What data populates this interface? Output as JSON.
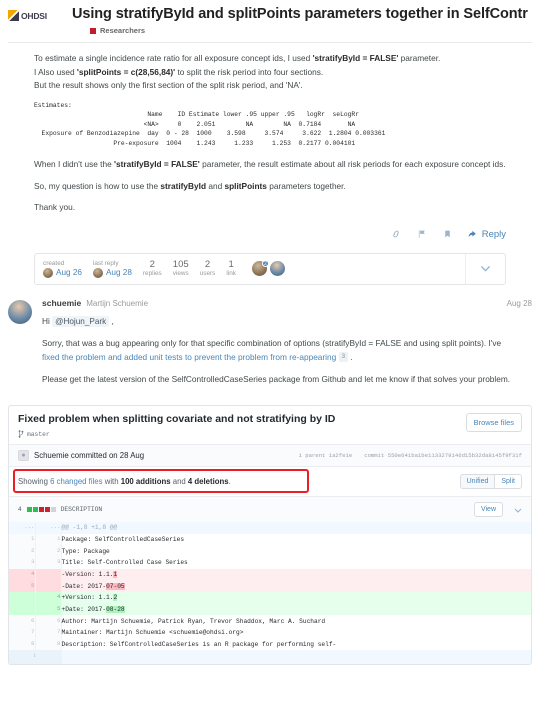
{
  "header": {
    "logo_text": "OHDSI",
    "topic_title": "Using stratifyById and splitPoints parameters together in SelfContr",
    "category": "Researchers"
  },
  "first_post": {
    "paragraphs": [
      {
        "parts": [
          {
            "t": "To estimate a single incidence rate ratio for all exposure concept ids, I used ",
            "b": false
          },
          {
            "t": "'stratifyById = FALSE'",
            "b": true
          },
          {
            "t": " parameter.",
            "b": false
          }
        ]
      },
      {
        "parts": [
          {
            "t": "I Also used ",
            "b": false
          },
          {
            "t": "'splitPoints = c(28,56,84)'",
            "b": true
          },
          {
            "t": " to split the risk period into four sections.",
            "b": false
          }
        ]
      },
      {
        "parts": [
          {
            "t": "But the result shows only the first section of the split risk period, and 'NA'.",
            "b": false
          }
        ]
      }
    ],
    "code_block": "Estimates:\n                              Name    ID Estimate lower .95 upper .95   logRr  seLogRr\n                             <NA>     0    2.051        NA        NA  0.7184       NA\n  Exposure of Benzodiazepine  day  0 - 28  1000    3.598     3.574     3.622  1.2804 0.003361\n                     Pre-exposure  1004    1.243     1.233     1.253  0.2177 0.004101",
    "paragraphs_after": [
      {
        "parts": [
          {
            "t": "When I didn't use the ",
            "b": false
          },
          {
            "t": "'stratifyById = FALSE'",
            "b": true
          },
          {
            "t": " parameter, the result estimate about all risk periods for each exposure concept ids.",
            "b": false
          }
        ]
      },
      {
        "parts": [
          {
            "t": "So, my question is how to use the ",
            "b": false
          },
          {
            "t": "stratifyById",
            "b": true
          },
          {
            "t": " and ",
            "b": false
          },
          {
            "t": "splitPoints",
            "b": true
          },
          {
            "t": " parameters together.",
            "b": false
          }
        ]
      },
      {
        "parts": [
          {
            "t": "Thank you.",
            "b": false
          }
        ]
      }
    ],
    "controls": {
      "link_icon": "link-icon",
      "flag_icon": "flag-icon",
      "bookmark_icon": "bookmark-icon",
      "reply_label": "Reply"
    }
  },
  "topic_map": {
    "created_label": "created",
    "created_date": "Aug 26",
    "last_reply_label": "last reply",
    "last_reply_date": "Aug 28",
    "stats": [
      {
        "value": "2",
        "label": "replies"
      },
      {
        "value": "105",
        "label": "views"
      },
      {
        "value": "2",
        "label": "users"
      },
      {
        "value": "1",
        "label": "link"
      }
    ],
    "avatar_badge": "2",
    "expand_icon": "chevron-down-icon"
  },
  "reply_post": {
    "username": "schuemie",
    "fullname": "Martijn Schuemie",
    "date": "Aug 28",
    "greeting_prefix": "Hi ",
    "mention": "@Hojun_Park",
    "greeting_suffix": " ,",
    "body_line1_a": "Sorry, that was a bug appearing only for that specific combination of options (stratifyById = FALSE and using split points). I've ",
    "body_line1_link": "fixed the problem and added unit tests to prevent the problem from re-appearing",
    "body_line1_ref": "3",
    "body_line1_b": " .",
    "body_line2": "Please get the latest version of the SelfControlledCaseSeries package from Github and let me know if that solves your problem."
  },
  "github_card": {
    "commit_title": "Fixed problem when splitting covariate and not stratifying by ID",
    "branch_icon": "branch-icon",
    "branch": "master",
    "browse_files": "Browse files",
    "committer_avatar": "avatar-icon",
    "committed_text": "Schuemie committed on 28 Aug",
    "parent_label": "1 parent 1a2fe1e",
    "commit_label": "commit 550e641ba1be1133279146d15b32da8145f9f31f",
    "showing": {
      "prefix": "Showing ",
      "files_link": "6 changed files",
      "mid": " with ",
      "additions": "100 additions",
      "and": " and ",
      "deletions": "4 deletions",
      "suffix": "."
    },
    "unified_label": "Unified",
    "split_label": "Split",
    "annotation_color": "#ee1c24",
    "diff_file": {
      "changes_count": "4",
      "filename": "DESCRIPTION",
      "view_label": "View",
      "collapse_icon": "chevron-down-icon",
      "rows": [
        {
          "type": "hunk",
          "old": "...",
          "new": "...",
          "code": "@@ -1,8 +1,8 @@"
        },
        {
          "type": "ctx",
          "old": "1",
          "new": "1",
          "code": "Package: SelfControlledCaseSeries"
        },
        {
          "type": "ctx",
          "old": "2",
          "new": "2",
          "code": "Type: Package"
        },
        {
          "type": "ctx",
          "old": "3",
          "new": "3",
          "code": "Title: Self-Controlled Case Series"
        },
        {
          "type": "del",
          "old": "4",
          "new": "",
          "code": "-Version: 1.1.1",
          "hl": "1"
        },
        {
          "type": "del",
          "old": "5",
          "new": "",
          "code": "-Date: 2017-07-05",
          "hl": "07-05"
        },
        {
          "type": "add",
          "old": "",
          "new": "4",
          "code": "+Version: 1.1.2",
          "hl": "2"
        },
        {
          "type": "add",
          "old": "",
          "new": "5",
          "code": "+Date: 2017-08-28",
          "hl": "08-28"
        },
        {
          "type": "ctx",
          "old": "6",
          "new": "6",
          "code": "Author: Martijn Schuemie, Patrick Ryan, Trevor Shaddox, Marc A. Suchard"
        },
        {
          "type": "ctx",
          "old": "7",
          "new": "7",
          "code": "Maintainer: Martijn Schuemie <schuemie@ohdsi.org>"
        },
        {
          "type": "ctx",
          "old": "8",
          "new": "8",
          "code": "Description: SelfControlledCaseSeries is an R package for performing self-"
        },
        {
          "type": "expander",
          "old": "",
          "new": "",
          "code": ""
        }
      ]
    }
  }
}
